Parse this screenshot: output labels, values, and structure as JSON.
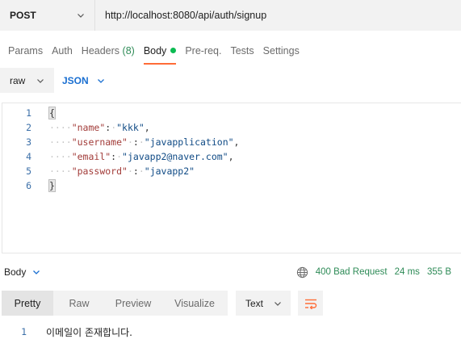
{
  "request": {
    "method": "POST",
    "url": "http://localhost:8080/api/auth/signup"
  },
  "tabs": [
    {
      "label": "Params"
    },
    {
      "label": "Auth"
    },
    {
      "label": "Headers",
      "count": "(8)"
    },
    {
      "label": "Body"
    },
    {
      "label": "Pre-req."
    },
    {
      "label": "Tests"
    },
    {
      "label": "Settings"
    }
  ],
  "body_type": {
    "mode": "raw",
    "language": "JSON"
  },
  "editor": {
    "line_numbers": [
      "1",
      "2",
      "3",
      "4",
      "5",
      "6"
    ],
    "open_brace": "{",
    "close_brace": "}",
    "fields": [
      {
        "key": "\"name\"",
        "sep_before": "",
        "colon": ":",
        "sep_after": " ",
        "value": "\"kkk\"",
        "comma": ","
      },
      {
        "key": "\"username\"",
        "sep_before": " ",
        "colon": ":",
        "sep_after": " ",
        "value": "\"javapplication\"",
        "comma": ","
      },
      {
        "key": "\"email\"",
        "sep_before": "",
        "colon": ":",
        "sep_after": " ",
        "value": "\"javapp2@naver.com\"",
        "comma": ","
      },
      {
        "key": "\"password\"",
        "sep_before": " ",
        "colon": ":",
        "sep_after": " ",
        "value": "\"javapp2\"",
        "comma": ""
      }
    ]
  },
  "response": {
    "section_label": "Body",
    "status": "400 Bad Request",
    "time": "24 ms",
    "size": "355 B",
    "views": [
      "Pretty",
      "Raw",
      "Preview",
      "Visualize"
    ],
    "format": "Text",
    "line_number": "1",
    "body_text": "이메일이 존재합니다."
  },
  "colors": {
    "accent_orange": "#ff6c37",
    "status_green": "#2e8b57",
    "link_blue": "#1a6fd1"
  }
}
